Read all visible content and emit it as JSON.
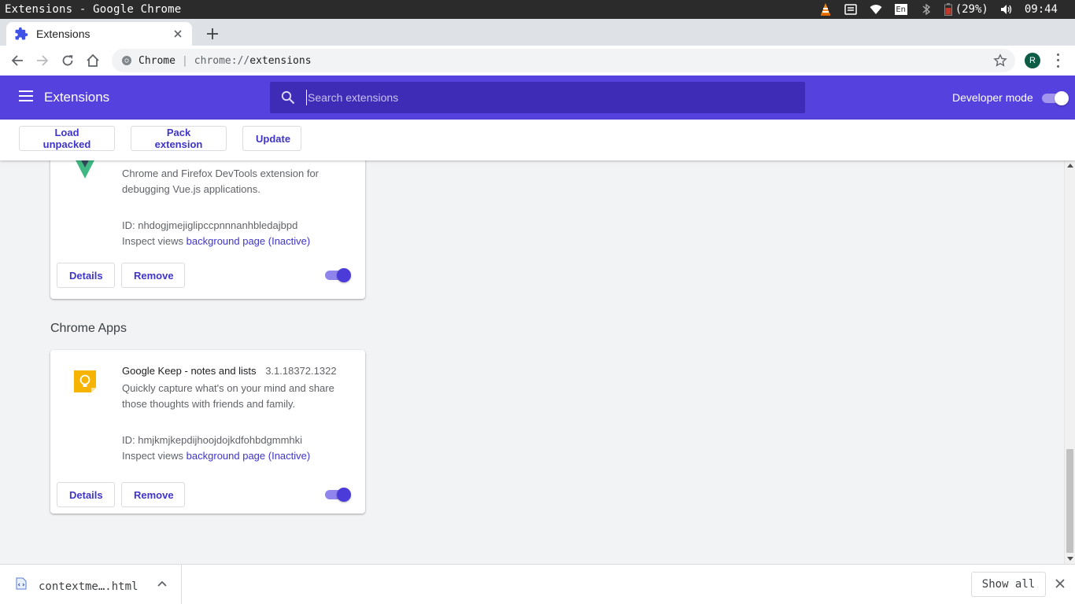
{
  "os": {
    "window_title": "Extensions - Google Chrome",
    "language": "En",
    "battery": "(29%)",
    "clock": "09:44"
  },
  "tab": {
    "label": "Extensions"
  },
  "omnibox": {
    "site": "Chrome",
    "separator": "|",
    "scheme": "chrome://",
    "path": "extensions"
  },
  "profile": {
    "initial": "R"
  },
  "header": {
    "title": "Extensions",
    "search_placeholder": "Search extensions",
    "developer_mode_label": "Developer mode",
    "developer_mode_on": true,
    "color": "#5541dd"
  },
  "dev_toolbar": {
    "load_unpacked": "Load unpacked",
    "pack_extension": "Pack extension",
    "update": "Update"
  },
  "extensions": [
    {
      "name": "",
      "version": "",
      "icon": "vue-logo-icon",
      "description": "Chrome and Firefox DevTools extension for debugging Vue.js applications.",
      "id_text": "ID: nhdogjmejiglipccpnnnanhbledajbpd",
      "inspect_label": "Inspect views",
      "inspect_link": "background page (Inactive)",
      "details_label": "Details",
      "remove_label": "Remove",
      "enabled": true
    }
  ],
  "chrome_apps": {
    "section_title": "Chrome Apps",
    "items": [
      {
        "name": "Google Keep - notes and lists",
        "version": "3.1.18372.1322",
        "icon": "google-keep-icon",
        "description": "Quickly capture what's on your mind and share those thoughts with friends and family.",
        "id_text": "ID: hmjkmjkepdijhoojdojkdfohbdgmmhki",
        "inspect_label": "Inspect views",
        "inspect_link": "background page (Inactive)",
        "details_label": "Details",
        "remove_label": "Remove",
        "enabled": true
      }
    ]
  },
  "download_shelf": {
    "file_name": "contextme….html",
    "show_all_label": "Show all"
  }
}
